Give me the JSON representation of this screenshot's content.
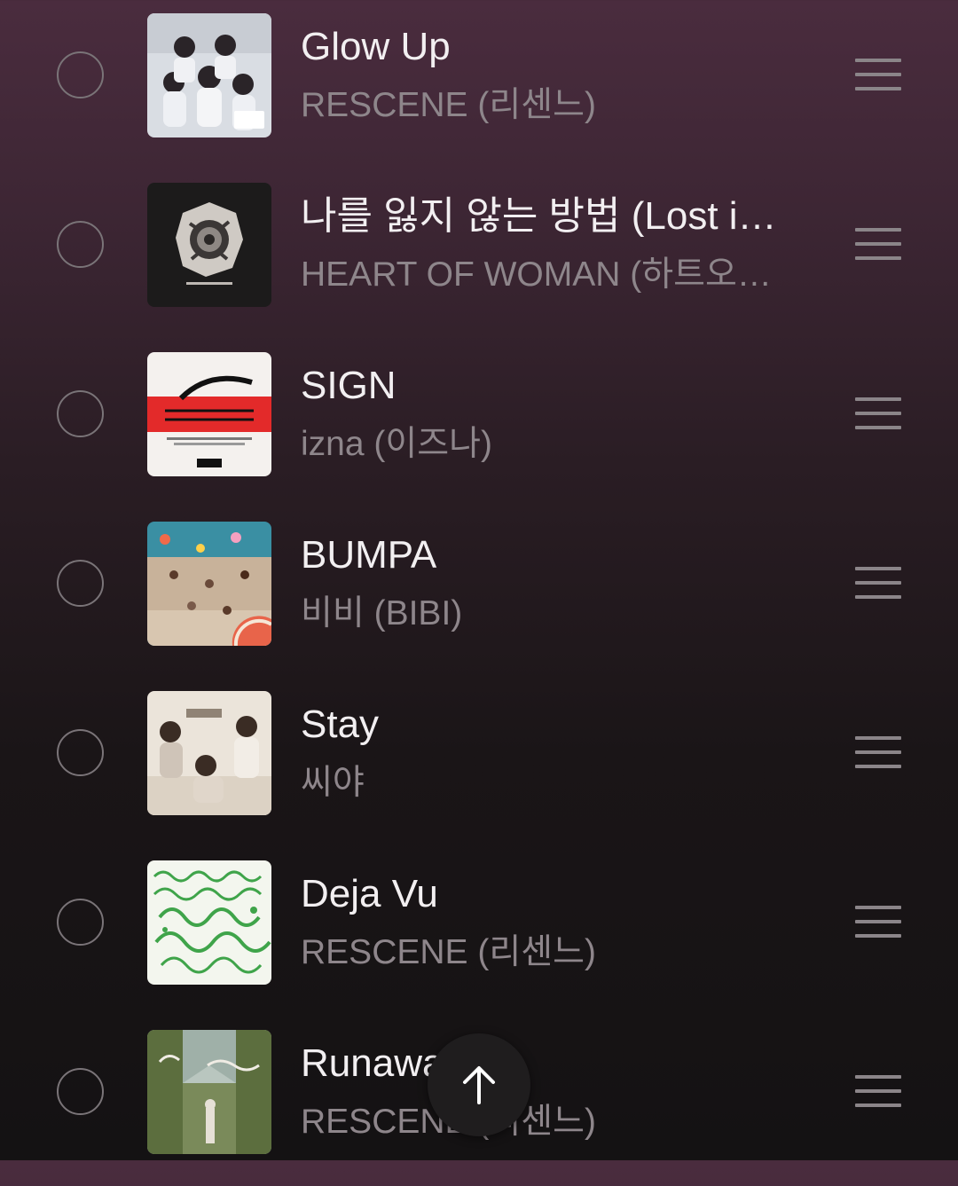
{
  "tracks": [
    {
      "title": "Glow Up",
      "artist": "RESCENE (리센느)",
      "cover": "girls-group-photo"
    },
    {
      "title": "나를 잃지 않는 방법 (Lost i…",
      "artist": "HEART OF WOMAN (하트오브…",
      "cover": "dark-abstract-art"
    },
    {
      "title": "SIGN",
      "artist": "izna (이즈나)",
      "cover": "red-sign-logo"
    },
    {
      "title": "BUMPA",
      "artist": "비비 (BIBI)",
      "cover": "beach-crowd"
    },
    {
      "title": "Stay",
      "artist": "씨야",
      "cover": "three-women-photo"
    },
    {
      "title": "Deja Vu",
      "artist": "RESCENE (리센느)",
      "cover": "green-script-lettering"
    },
    {
      "title": "Runaway",
      "artist": "RESCENE (리센느)",
      "cover": "hedge-maze-deer"
    }
  ],
  "colors": {
    "background_top": "#4a2c3e",
    "background_bottom": "#141213",
    "title_text": "#f2eff1",
    "artist_text": "#8e868b"
  },
  "icons": {
    "select": "radio-circle-icon",
    "reorder": "drag-handle-icon",
    "scroll_top": "arrow-up-icon"
  }
}
